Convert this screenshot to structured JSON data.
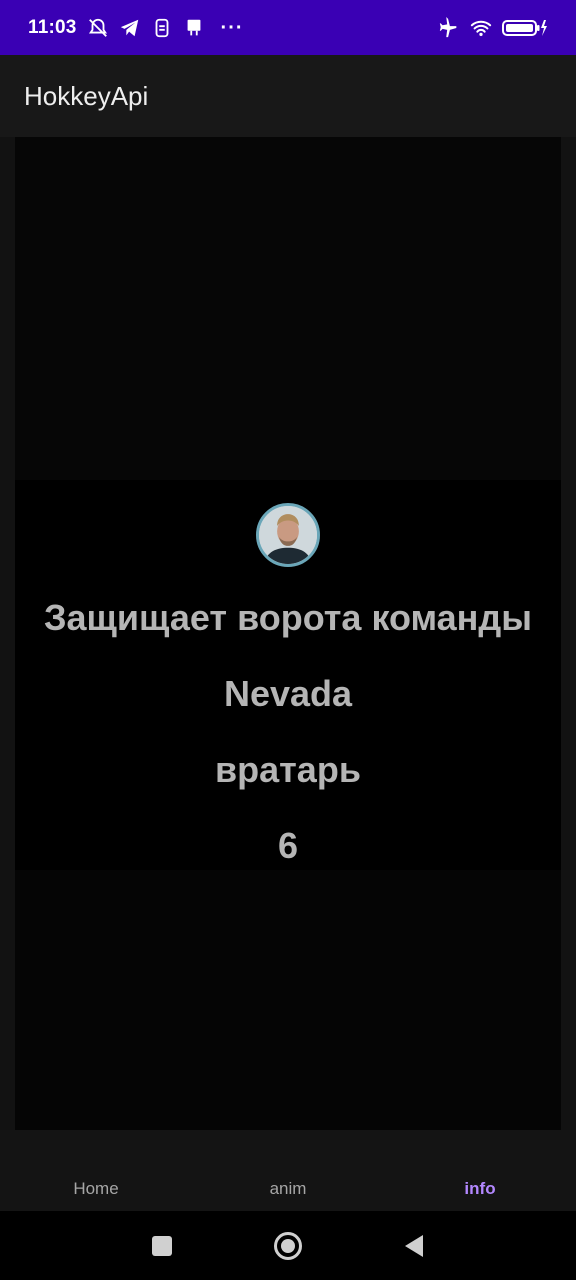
{
  "status_bar": {
    "time": "11:03",
    "left_icons": [
      "muted-notification-icon",
      "telegram-icon",
      "sim-icon",
      "usb-icon"
    ],
    "overflow": "···",
    "right_icons": [
      "airplane-mode-icon",
      "wifi-icon",
      "battery-charging-icon"
    ],
    "background": "#3a00b4"
  },
  "app_bar": {
    "title": "HokkeyApi"
  },
  "player": {
    "team_label": "Защищает ворота команды",
    "team": "Nevada",
    "position": "вратарь",
    "number": "6"
  },
  "bottom_nav": {
    "items": [
      {
        "label": "Home",
        "active": false
      },
      {
        "label": "anim",
        "active": false
      },
      {
        "label": "info",
        "active": true
      }
    ],
    "active_color": "#b388ff"
  },
  "system_nav": {
    "buttons": [
      "recents-button",
      "home-button",
      "back-button"
    ]
  }
}
